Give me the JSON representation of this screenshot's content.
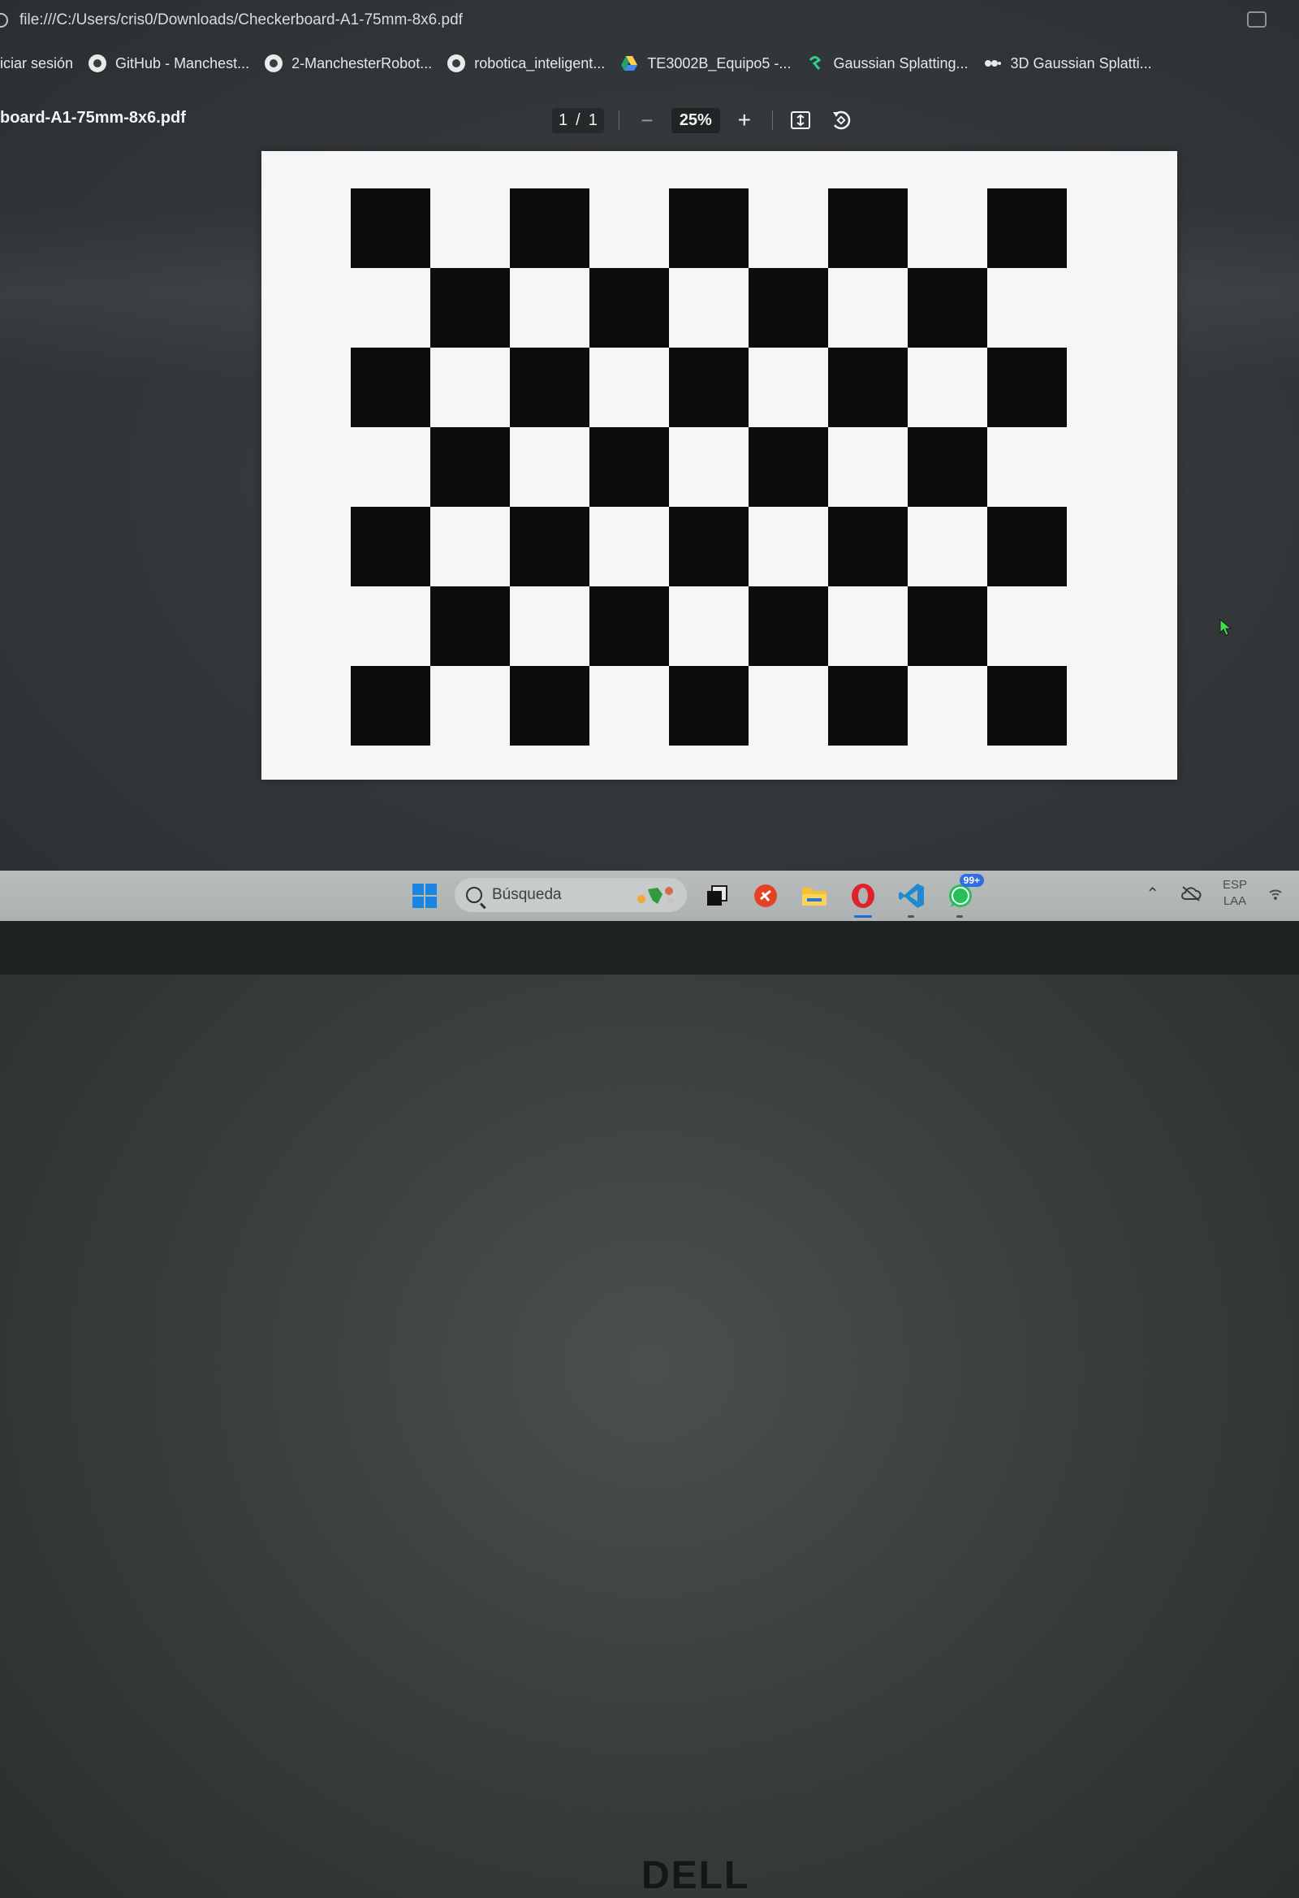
{
  "browser": {
    "url": "file:///C:/Users/cris0/Downloads/Checkerboard-A1-75mm-8x6.pdf",
    "bookmarks": [
      {
        "label": "iciar sesión",
        "icon": "none"
      },
      {
        "label": "GitHub - Manchest...",
        "icon": "github-icon"
      },
      {
        "label": "2-ManchesterRobot...",
        "icon": "github-icon"
      },
      {
        "label": "robotica_inteligent...",
        "icon": "github-icon"
      },
      {
        "label": "TE3002B_Equipo5 -...",
        "icon": "google-drive-icon"
      },
      {
        "label": "Gaussian Splatting...",
        "icon": "bookmark-app-icon"
      },
      {
        "label": "3D Gaussian Splatti...",
        "icon": "bookmark-dots-icon"
      }
    ]
  },
  "pdf_viewer": {
    "file_title": "board-A1-75mm-8x6.pdf",
    "current_page": "1",
    "page_separator": "/",
    "total_pages": "1",
    "zoom": "25%",
    "zoom_out_label": "−",
    "zoom_in_label": "+"
  },
  "document": {
    "columns": 9,
    "rows": 7
  },
  "taskbar": {
    "search_placeholder": "Búsqueda",
    "whatsapp_badge": "99+",
    "language": "ESP",
    "keyboard": "LAA"
  },
  "bezel": {
    "brand": "DELL"
  },
  "colors": {
    "viewer_background": "#3a3e40",
    "page": "#f6f6f6",
    "square": "#0c0c0c",
    "taskbar": "#b3b6b7",
    "opera_red": "#e0202b",
    "vscode_blue": "#1f8ad2"
  }
}
